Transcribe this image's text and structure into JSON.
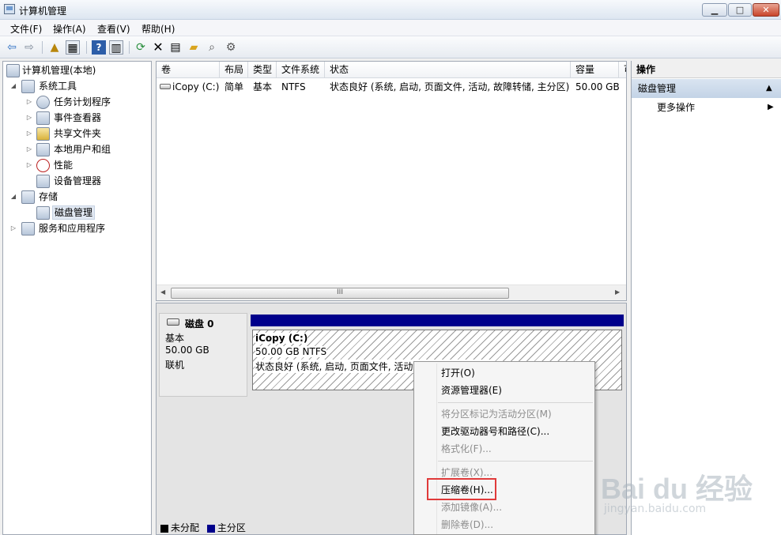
{
  "window": {
    "title": "计算机管理"
  },
  "window_controls": {
    "minimize": "▁",
    "maximize": "□",
    "close": "✕"
  },
  "menu": [
    "文件(F)",
    "操作(A)",
    "查看(V)",
    "帮助(H)"
  ],
  "tree": [
    {
      "label": "计算机管理(本地)",
      "icon": "computer-icon"
    },
    {
      "label": "系统工具",
      "icon": "tools-icon"
    },
    {
      "label": "任务计划程序",
      "icon": "clock-icon"
    },
    {
      "label": "事件查看器",
      "icon": "event-viewer-icon"
    },
    {
      "label": "共享文件夹",
      "icon": "shared-folder-icon"
    },
    {
      "label": "本地用户和组",
      "icon": "users-icon"
    },
    {
      "label": "性能",
      "icon": "performance-icon"
    },
    {
      "label": "设备管理器",
      "icon": "device-manager-icon"
    },
    {
      "label": "存储",
      "icon": "storage-icon"
    },
    {
      "label": "磁盘管理",
      "icon": "disk-management-icon"
    },
    {
      "label": "服务和应用程序",
      "icon": "services-icon"
    }
  ],
  "volumes": {
    "columns": [
      "卷",
      "布局",
      "类型",
      "文件系统",
      "状态",
      "容量",
      "可"
    ],
    "rows": [
      [
        "iCopy (C:)",
        "简单",
        "基本",
        "NTFS",
        "状态良好 (系统, 启动, 页面文件, 活动, 故障转储, 主分区)",
        "50.00 GB"
      ]
    ],
    "scroll_thumb": "III"
  },
  "disk": {
    "name": "磁盘 0",
    "type": "基本",
    "size": "50.00 GB",
    "status": "联机",
    "partition": {
      "name": "iCopy  (C:)",
      "size_fs": "50.00 GB NTFS",
      "status": "状态良好 (系统, 启动, 页面文件, 活动, 故障转储, 主分区)"
    }
  },
  "legend": [
    {
      "label": "未分配",
      "color": "#000000"
    },
    {
      "label": "主分区",
      "color": "#00008b"
    }
  ],
  "actions": {
    "header": "操作",
    "section": "磁盘管理",
    "more": "更多操作"
  },
  "context_menu": [
    {
      "label": "打开(O)",
      "enabled": true
    },
    {
      "label": "资源管理器(E)",
      "enabled": true
    },
    {
      "label": "将分区标记为活动分区(M)",
      "enabled": false
    },
    {
      "label": "更改驱动器号和路径(C)...",
      "enabled": true
    },
    {
      "label": "格式化(F)...",
      "enabled": false
    },
    {
      "label": "扩展卷(X)...",
      "enabled": false
    },
    {
      "label": "压缩卷(H)...",
      "enabled": true
    },
    {
      "label": "添加镜像(A)...",
      "enabled": false
    },
    {
      "label": "删除卷(D)...",
      "enabled": false
    }
  ],
  "watermark": {
    "brand": "Bai du 经验",
    "url": "jingyan.baidu.com"
  }
}
